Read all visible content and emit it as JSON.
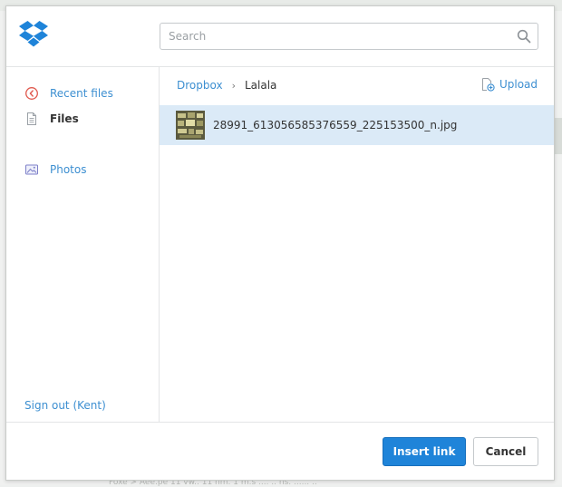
{
  "colors": {
    "accent": "#3d8fd1",
    "primary_button": "#1f84d9",
    "selected_row": "#dbeaf7",
    "logo": "#1f84d9"
  },
  "header": {
    "logo_icon": "dropbox-logo",
    "search": {
      "placeholder": "Search",
      "value": "",
      "icon": "search-icon"
    }
  },
  "sidebar": {
    "items": [
      {
        "label": "Recent files",
        "icon": "clock-icon",
        "active": false
      },
      {
        "label": "Files",
        "icon": "file-icon",
        "active": true
      },
      {
        "label": "Photos",
        "icon": "photo-icon",
        "active": false
      }
    ],
    "signout_label": "Sign out (Kent)"
  },
  "main": {
    "breadcrumb": {
      "root": "Dropbox",
      "separator": "›",
      "current": "Lalala"
    },
    "upload_label": "Upload",
    "files": [
      {
        "name": "28991_613056585376559_225153500_n.jpg",
        "selected": true
      }
    ]
  },
  "footer": {
    "insert_label": "Insert link",
    "cancel_label": "Cancel"
  },
  "background": {
    "faint_text": "Foxe > Aee.pe 11 vw.. 11 nm. 1 m.s .... .. ns. ...... .."
  }
}
